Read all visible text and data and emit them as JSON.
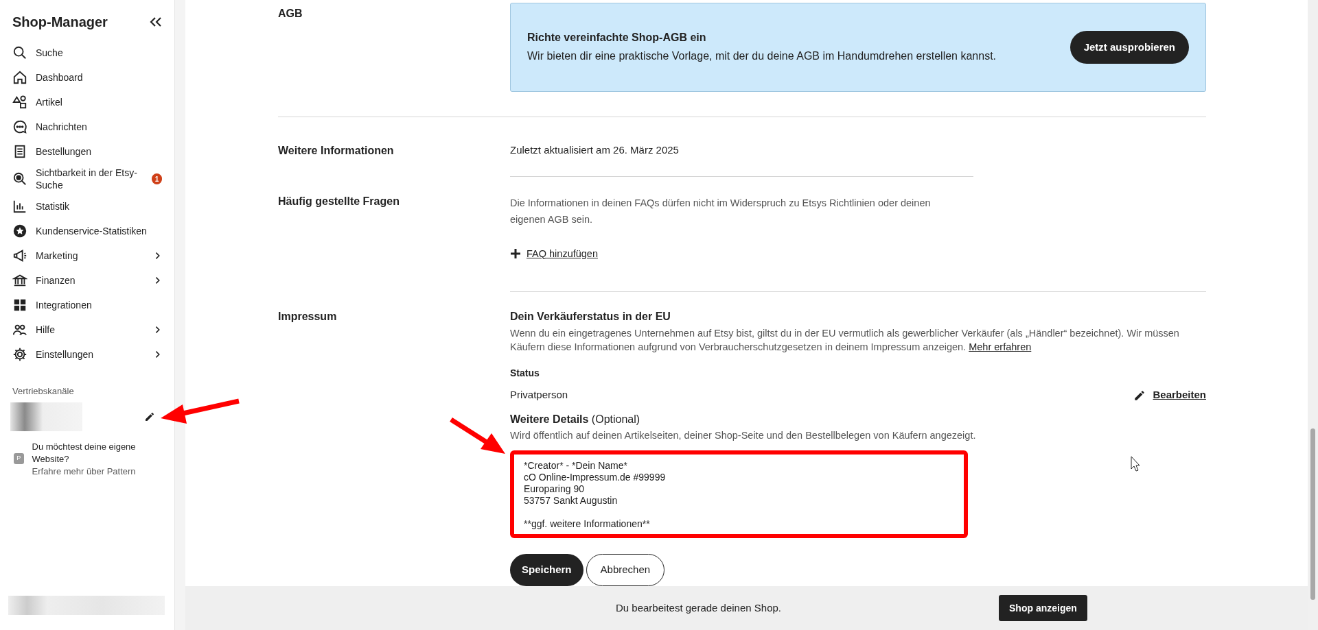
{
  "sidebar": {
    "title": "Shop-Manager",
    "items": [
      {
        "label": "Suche",
        "chevron": false
      },
      {
        "label": "Dashboard",
        "chevron": false
      },
      {
        "label": "Artikel",
        "chevron": false
      },
      {
        "label": "Nachrichten",
        "chevron": false
      },
      {
        "label": "Bestellungen",
        "chevron": false
      },
      {
        "label": "Sichtbarkeit in der Etsy-Suche",
        "chevron": false,
        "badge": "1"
      },
      {
        "label": "Statistik",
        "chevron": false
      },
      {
        "label": "Kundenservice-Statistiken",
        "chevron": false
      },
      {
        "label": "Marketing",
        "chevron": true
      },
      {
        "label": "Finanzen",
        "chevron": true
      },
      {
        "label": "Integrationen",
        "chevron": false
      },
      {
        "label": "Hilfe",
        "chevron": true
      },
      {
        "label": "Einstellungen",
        "chevron": true
      }
    ],
    "channels_heading": "Vertriebskanäle",
    "promo": {
      "badge": "P",
      "text": "Du möchtest deine eigene Website?",
      "link": "Erfahre mehr über Pattern"
    }
  },
  "sections": {
    "agb": {
      "label": "AGB",
      "banner_title": "Richte vereinfachte Shop-AGB ein",
      "banner_text": "Wir bieten dir eine praktische Vorlage, mit der du deine AGB im Handumdrehen erstellen kannst.",
      "banner_button": "Jetzt ausprobieren"
    },
    "more_info": {
      "label": "Weitere Informationen",
      "updated": "Zuletzt aktualisiert am 26. März 2025"
    },
    "faq": {
      "label": "Häufig gestellte Fragen",
      "text": "Die Informationen in deinen FAQs dürfen nicht im Widerspruch zu Etsys Richtlinien oder deinen eigenen AGB sein.",
      "add_link": "FAQ hinzufügen"
    },
    "imprint": {
      "label": "Impressum",
      "heading": "Dein Verkäuferstatus in der EU",
      "text": "Wenn du ein eingetragenes Unternehmen auf Etsy bist, giltst du in der EU vermutlich als gewerblicher Verkäufer (als „Händler“ bezeichnet). Wir müssen Käufern diese Informationen aufgrund von Verbraucherschutzgesetzen in deinem Impressum anzeigen.",
      "more_link": "Mehr erfahren",
      "status_label": "Status",
      "status_value": "Privatperson",
      "edit_link": "Bearbeiten",
      "details_heading": "Weitere Details",
      "details_optional": "(Optional)",
      "details_hint": "Wird öffentlich auf deinen Artikelseiten, deiner Shop-Seite und den Bestellbelegen von Käufern angezeigt.",
      "details_value": "*Creator* - *Dein Name*\ncO Online-Impressum.de #99999\nEuroparing 90\n53757 Sankt Augustin\n\n**ggf. weitere Informationen**",
      "save_button": "Speichern",
      "cancel_button": "Abbrechen"
    }
  },
  "bottom_bar": {
    "text": "Du bearbeitest gerade deinen Shop.",
    "button": "Shop anzeigen"
  }
}
